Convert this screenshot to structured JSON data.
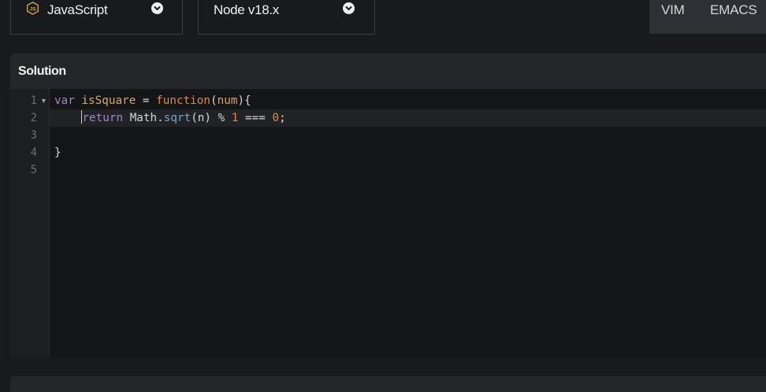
{
  "language_select": {
    "value": "JavaScript",
    "icon": "nodejs-icon"
  },
  "version_select": {
    "value": "Node v18.x"
  },
  "keybinding_modes": {
    "vim": "VIM",
    "emacs": "EMACS"
  },
  "panel": {
    "title": "Solution"
  },
  "editor": {
    "line_numbers": [
      "1",
      "2",
      "3",
      "4",
      "5"
    ],
    "lines": [
      [
        {
          "t": "var",
          "c": "kw"
        },
        {
          "t": " ",
          "c": "plain"
        },
        {
          "t": "isSquare",
          "c": "id"
        },
        {
          "t": " = ",
          "c": "plain"
        },
        {
          "t": "function",
          "c": "fn"
        },
        {
          "t": "(",
          "c": "plain"
        },
        {
          "t": "num",
          "c": "id"
        },
        {
          "t": "){",
          "c": "plain"
        }
      ],
      [
        {
          "t": "    ",
          "c": "plain"
        },
        {
          "t": "return",
          "c": "kw"
        },
        {
          "t": " Math.",
          "c": "plain"
        },
        {
          "t": "sqrt",
          "c": "prop"
        },
        {
          "t": "(n) % ",
          "c": "plain"
        },
        {
          "t": "1",
          "c": "num"
        },
        {
          "t": " === ",
          "c": "plain"
        },
        {
          "t": "0",
          "c": "num"
        },
        {
          "t": ";",
          "c": "plain"
        }
      ],
      [],
      [
        {
          "t": "}",
          "c": "plain"
        }
      ],
      []
    ]
  },
  "colors": {
    "keyword": "#a585c7",
    "function": "#d98b4c",
    "identifier": "#d4a96a",
    "number": "#d98b4c",
    "property": "#7aa2c8"
  }
}
